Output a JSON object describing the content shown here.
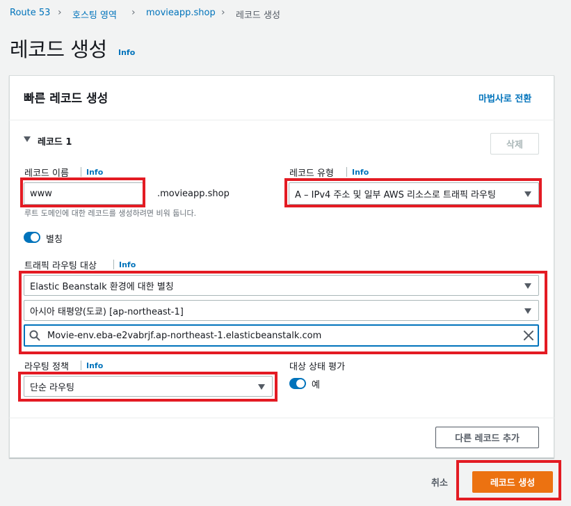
{
  "breadcrumb": {
    "items": [
      "Route 53",
      "호스팅 영역",
      "movieapp.shop"
    ],
    "current": "레코드 생성"
  },
  "page": {
    "title": "레코드 생성",
    "info": "Info"
  },
  "quick_create": {
    "title": "빠른 레코드 생성",
    "switch_to_wizard": "마법사로 전환",
    "record": {
      "header": "레코드 1",
      "delete_label": "삭제",
      "record_name": {
        "label": "레코드 이름",
        "info": "Info",
        "value": "www",
        "suffix": ".movieapp.shop",
        "hint": "루트 도메인에 대한 레코드를 생성하려면 비워 둡니다."
      },
      "record_type": {
        "label": "레코드 유형",
        "info": "Info",
        "value": "A – IPv4 주소 및 일부 AWS 리소스로 트래픽 라우팅"
      },
      "alias": {
        "label": "별칭",
        "enabled": true
      },
      "traffic_target": {
        "label": "트래픽 라우팅 대상",
        "info": "Info",
        "endpoint": "Elastic Beanstalk 환경에 대한 별칭",
        "region": "아시아 태평양(도쿄) [ap-northeast-1]",
        "environment": "Movie-env.eba-e2vabrjf.ap-northeast-1.elasticbeanstalk.com"
      },
      "routing_policy": {
        "label": "라우팅 정책",
        "info": "Info",
        "value": "단순 라우팅"
      },
      "health_eval": {
        "label": "대상 상태 평가",
        "value": "예",
        "enabled": true
      }
    },
    "add_record_label": "다른 레코드 추가"
  },
  "footer": {
    "cancel_label": "취소",
    "create_label": "레코드 생성"
  },
  "colors": {
    "highlight": "#e31b23",
    "primary": "#ec7211",
    "link": "#0073bb"
  }
}
